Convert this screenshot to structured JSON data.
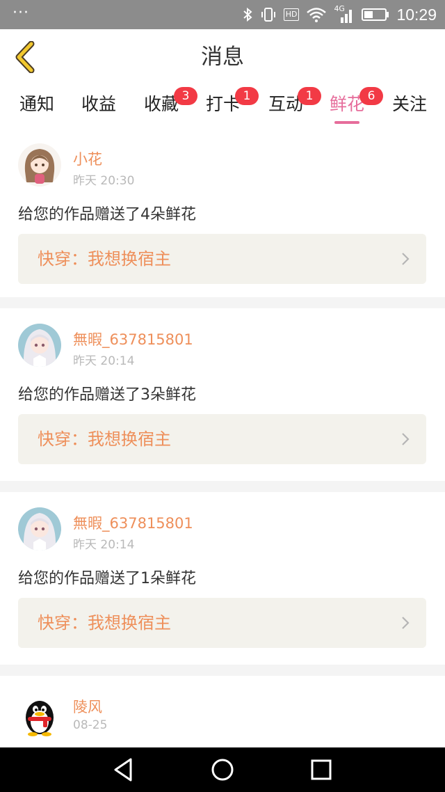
{
  "status_bar": {
    "time": "10:29",
    "network": "4G",
    "hd_label": "HD",
    "icons": [
      "more-dots-icon",
      "bluetooth-icon",
      "vibrate-icon",
      "hd-icon",
      "wifi-icon",
      "signal-icon",
      "battery-icon"
    ]
  },
  "header": {
    "title": "消息",
    "back_icon": "chevron-left-icon",
    "accent_color": "#e66d9b",
    "back_color": "#f2c82e"
  },
  "tabs": [
    {
      "label": "通知",
      "badge": ""
    },
    {
      "label": "收益",
      "badge": ""
    },
    {
      "label": "收藏",
      "badge": "3"
    },
    {
      "label": "打卡",
      "badge": "1"
    },
    {
      "label": "互动",
      "badge": "1"
    },
    {
      "label": "鲜花",
      "badge": "6",
      "active": true
    },
    {
      "label": "关注",
      "badge": ""
    }
  ],
  "messages": [
    {
      "user": "小花",
      "time": "昨天 20:30",
      "text": "给您的作品赠送了4朵鲜花",
      "book": "快穿：我想换宿主",
      "avatar": "girl-brown-hair-avatar"
    },
    {
      "user": "無暇_637815801",
      "time": "昨天 20:14",
      "text": "给您的作品赠送了3朵鲜花",
      "book": "快穿：我想换宿主",
      "avatar": "girl-white-hair-avatar"
    },
    {
      "user": "無暇_637815801",
      "time": "昨天 20:14",
      "text": "给您的作品赠送了1朵鲜花",
      "book": "快穿：我想换宿主",
      "avatar": "girl-white-hair-avatar"
    },
    {
      "user": "陵风",
      "time": "08-25",
      "text": "",
      "book": "",
      "avatar": "penguin-avatar"
    }
  ],
  "nav_bar": {
    "icons": [
      "back-triangle-icon",
      "home-circle-icon",
      "recents-square-icon"
    ]
  }
}
